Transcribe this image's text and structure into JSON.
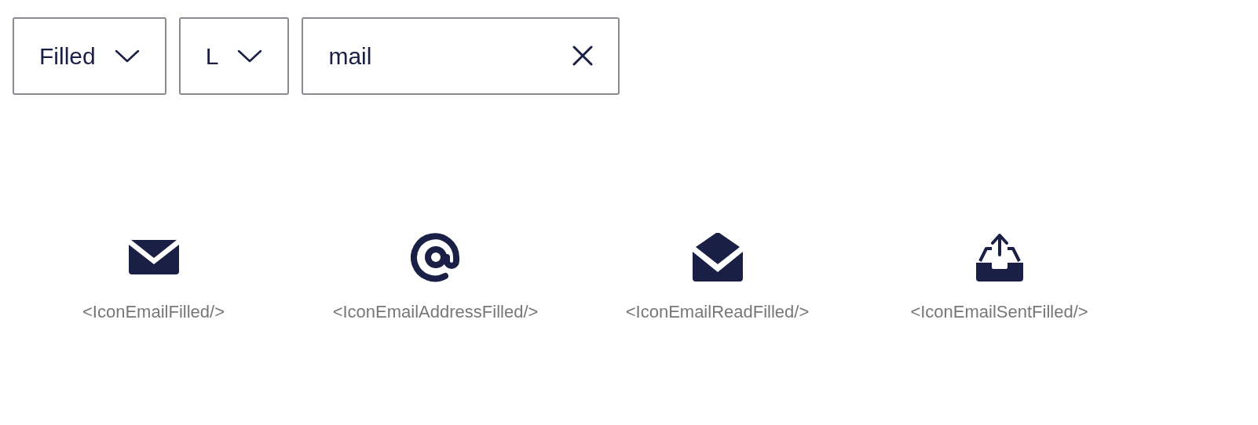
{
  "filters": [
    {
      "kind": "select",
      "value": "Filled",
      "expanded": false
    },
    {
      "kind": "select",
      "value": "L",
      "expanded": false
    },
    {
      "kind": "search",
      "value": "mail"
    }
  ],
  "icons": [
    {
      "kind": "envelope",
      "label": "<IconEmailFilled/>"
    },
    {
      "kind": "at",
      "label": "<IconEmailAddressFilled/>"
    },
    {
      "kind": "envelope-open",
      "label": "<IconEmailReadFilled/>"
    },
    {
      "kind": "inbox-out",
      "label": "<IconEmailSentFilled/>"
    }
  ]
}
